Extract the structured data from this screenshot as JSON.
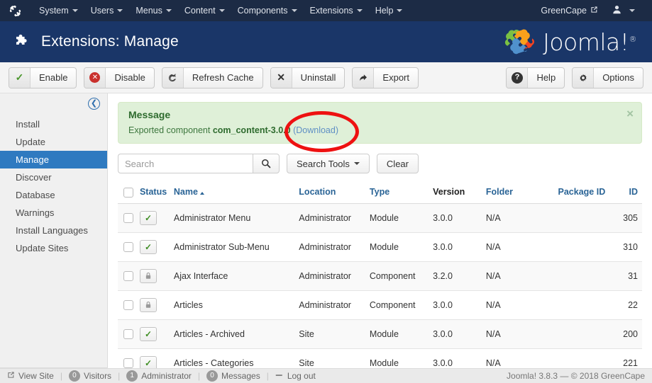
{
  "topbar": {
    "logo_icon": "joomla-mark-icon",
    "menu": [
      {
        "label": "System",
        "has_caret": true
      },
      {
        "label": "Users",
        "has_caret": true
      },
      {
        "label": "Menus",
        "has_caret": true
      },
      {
        "label": "Content",
        "has_caret": true
      },
      {
        "label": "Components",
        "has_caret": true
      },
      {
        "label": "Extensions",
        "has_caret": true
      },
      {
        "label": "Help",
        "has_caret": true
      }
    ],
    "site_name": "GreenCape",
    "site_link_icon": "external-link-icon",
    "user_icon": "user-icon"
  },
  "header": {
    "title": "Extensions: Manage",
    "icon": "puzzle-piece-icon",
    "brand": "Joomla!",
    "brand_reg": "®"
  },
  "toolbar": {
    "left_buttons": [
      {
        "label": "Enable",
        "icon": "check-icon"
      },
      {
        "label": "Disable",
        "icon": "circle-x-icon"
      },
      {
        "label": "Refresh Cache",
        "icon": "refresh-icon"
      },
      {
        "label": "Uninstall",
        "icon": "x-icon"
      },
      {
        "label": "Export",
        "icon": "share-arrow-icon"
      }
    ],
    "right_buttons": [
      {
        "label": "Help",
        "icon": "question-circle-icon"
      },
      {
        "label": "Options",
        "icon": "gear-icon"
      }
    ]
  },
  "sidebar": {
    "collapse_icon": "arrow-circle-left-icon",
    "items": [
      {
        "label": "Install",
        "active": false
      },
      {
        "label": "Update",
        "active": false
      },
      {
        "label": "Manage",
        "active": true
      },
      {
        "label": "Discover",
        "active": false
      },
      {
        "label": "Database",
        "active": false
      },
      {
        "label": "Warnings",
        "active": false
      },
      {
        "label": "Install Languages",
        "active": false
      },
      {
        "label": "Update Sites",
        "active": false
      }
    ]
  },
  "message": {
    "title": "Message",
    "text_before": "Exported component ",
    "component": "com_content-3.0.0",
    "text_after": " ",
    "download_label": "(Download)",
    "close_icon": "close-icon",
    "annotation": "red-ellipse-highlight"
  },
  "search": {
    "placeholder": "Search",
    "value": "",
    "search_icon": "search-icon",
    "tools_label": "Search Tools",
    "clear_label": "Clear"
  },
  "table": {
    "columns": [
      {
        "key": "check",
        "label": "",
        "sortable": false
      },
      {
        "key": "status",
        "label": "Status",
        "sortable": true
      },
      {
        "key": "name",
        "label": "Name",
        "sortable": true,
        "sorted": "asc"
      },
      {
        "key": "location",
        "label": "Location",
        "sortable": true
      },
      {
        "key": "type",
        "label": "Type",
        "sortable": true
      },
      {
        "key": "version",
        "label": "Version",
        "sortable": false
      },
      {
        "key": "folder",
        "label": "Folder",
        "sortable": true
      },
      {
        "key": "package_id",
        "label": "Package ID",
        "sortable": true
      },
      {
        "key": "id",
        "label": "ID",
        "sortable": true
      }
    ],
    "rows": [
      {
        "status": "enabled",
        "status_icon": "check-icon",
        "name": "Administrator Menu",
        "location": "Administrator",
        "type": "Module",
        "version": "3.0.0",
        "folder": "N/A",
        "package_id": "",
        "id": "305"
      },
      {
        "status": "enabled",
        "status_icon": "check-icon",
        "name": "Administrator Sub-Menu",
        "location": "Administrator",
        "type": "Module",
        "version": "3.0.0",
        "folder": "N/A",
        "package_id": "",
        "id": "310"
      },
      {
        "status": "locked",
        "status_icon": "lock-icon",
        "name": "Ajax Interface",
        "location": "Administrator",
        "type": "Component",
        "version": "3.2.0",
        "folder": "N/A",
        "package_id": "",
        "id": "31"
      },
      {
        "status": "locked",
        "status_icon": "lock-icon",
        "name": "Articles",
        "location": "Administrator",
        "type": "Component",
        "version": "3.0.0",
        "folder": "N/A",
        "package_id": "",
        "id": "22"
      },
      {
        "status": "enabled",
        "status_icon": "check-icon",
        "name": "Articles - Archived",
        "location": "Site",
        "type": "Module",
        "version": "3.0.0",
        "folder": "N/A",
        "package_id": "",
        "id": "200"
      },
      {
        "status": "enabled",
        "status_icon": "check-icon",
        "name": "Articles - Categories",
        "location": "Site",
        "type": "Module",
        "version": "3.0.0",
        "folder": "N/A",
        "package_id": "",
        "id": "221"
      }
    ]
  },
  "footer": {
    "items": [
      {
        "label": "View Site",
        "icon": "external-link-icon",
        "count": null
      },
      {
        "label": "Visitors",
        "icon": null,
        "count": "0"
      },
      {
        "label": "Administrator",
        "icon": null,
        "count": "1"
      },
      {
        "label": "Messages",
        "icon": null,
        "count": "0"
      },
      {
        "label": "Log out",
        "icon": "logout-icon",
        "count": null
      }
    ],
    "copyright": "Joomla! 3.8.3 — © 2018 GreenCape"
  },
  "colors": {
    "topbar_bg": "#1c2b45",
    "subhead_bg": "#1a3668",
    "sidebar_active": "#2f7ac0",
    "alert_bg": "#dff0d8",
    "alert_text": "#3c763d",
    "annotation_red": "#ee1111",
    "link_blue": "#2a6496"
  }
}
